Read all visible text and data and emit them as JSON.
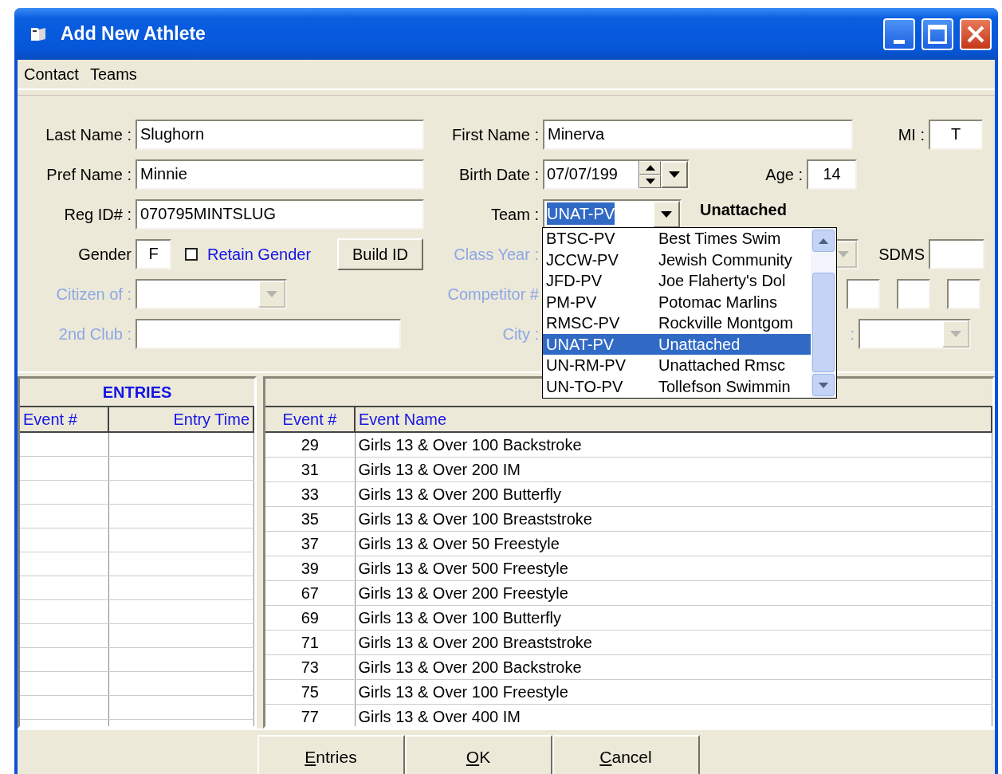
{
  "window": {
    "title": "Add New Athlete"
  },
  "menu": [
    {
      "label": "Contact"
    },
    {
      "label": "Teams"
    }
  ],
  "form": {
    "rows": [
      [
        {
          "kind": "text",
          "label": "Last Name :",
          "value": "Slughorn",
          "disabled": false,
          "highlighted": false
        },
        {
          "kind": "text",
          "label": "First Name :",
          "value": "Minerva",
          "disabled": false,
          "highlighted": false
        },
        {
          "kind": "text",
          "label": "MI :",
          "value": "T",
          "disabled": false,
          "highlighted": false
        }
      ],
      [
        {
          "kind": "text",
          "label": "Pref Name :",
          "value": "Minnie",
          "disabled": false,
          "highlighted": false
        },
        {
          "kind": "date",
          "label": "Birth Date :",
          "value": "07/07/199",
          "disabled": false,
          "highlighted": false
        },
        {
          "kind": "text",
          "label": "Age :",
          "value": "14",
          "disabled": false,
          "highlighted": false
        }
      ],
      [
        {
          "kind": "text",
          "label": "Reg ID# :",
          "value": "070795MINTSLUG",
          "disabled": false,
          "highlighted": false
        },
        {
          "kind": "combo",
          "label": "Team :",
          "value": "UNAT-PV",
          "disabled": false,
          "highlighted": true
        },
        {
          "kind": "note",
          "label": "Unattached"
        }
      ],
      [
        {
          "kind": "text",
          "label": "Gender",
          "value": "F",
          "disabled": false,
          "highlighted": false
        },
        {
          "kind": "checkbox",
          "label": "Retain Gender",
          "checked": false
        },
        {
          "kind": "button",
          "label": "Build ID"
        },
        {
          "kind": "combo",
          "label": "Class Year :",
          "disabled": true
        },
        {
          "kind": "text",
          "label": "SDMS",
          "disabled": false
        }
      ],
      [
        {
          "kind": "combo",
          "label": "Citizen of :",
          "disabled": true
        },
        {
          "kind": "multi",
          "label": "Competitor #",
          "disabled": true
        }
      ],
      [
        {
          "kind": "text",
          "label": "2nd Club :",
          "disabled": true
        },
        {
          "kind": "text",
          "label": "City :",
          "disabled": true
        },
        {
          "kind": "combo",
          "label": ":",
          "disabled": true
        }
      ]
    ]
  },
  "team_dropdown": {
    "items": [
      {
        "code": "BTSC-PV",
        "name": "Best Times Swim",
        "selected": false
      },
      {
        "code": "JCCW-PV",
        "name": "Jewish Community",
        "selected": false
      },
      {
        "code": "JFD-PV",
        "name": "Joe Flaherty's Dol",
        "selected": false
      },
      {
        "code": "PM-PV",
        "name": "Potomac Marlins",
        "selected": false
      },
      {
        "code": "RMSC-PV",
        "name": "Rockville Montgom",
        "selected": false
      },
      {
        "code": "UNAT-PV",
        "name": "Unattached",
        "selected": true
      },
      {
        "code": "UN-RM-PV",
        "name": "Unattached Rmsc",
        "selected": false
      },
      {
        "code": "UN-TO-PV",
        "name": "Tollefson Swimmin",
        "selected": false
      }
    ]
  },
  "entries_grid": {
    "title": "ENTRIES",
    "columns": [
      "Event #",
      "Entry Time"
    ]
  },
  "events_grid": {
    "columns": [
      "Event #",
      "Event Name"
    ],
    "rows": [
      [
        "29",
        "Girls 13 & Over 100 Backstroke"
      ],
      [
        "31",
        "Girls 13 & Over 200 IM"
      ],
      [
        "33",
        "Girls 13 & Over 200 Butterfly"
      ],
      [
        "35",
        "Girls 13 & Over 100 Breaststroke"
      ],
      [
        "37",
        "Girls 13 & Over 50 Freestyle"
      ],
      [
        "39",
        "Girls 13 & Over 500 Freestyle"
      ],
      [
        "67",
        "Girls 13 & Over 200 Freestyle"
      ],
      [
        "69",
        "Girls 13 & Over 100 Butterfly"
      ],
      [
        "71",
        "Girls 13 & Over 200 Breaststroke"
      ],
      [
        "73",
        "Girls 13 & Over 200 Backstroke"
      ],
      [
        "75",
        "Girls 13 & Over 100 Freestyle"
      ],
      [
        "77",
        "Girls 13 & Over 400 IM"
      ]
    ]
  },
  "buttons": [
    {
      "access_key": "E",
      "rest": "ntries"
    },
    {
      "access_key": "O",
      "rest": "K"
    },
    {
      "access_key": "C",
      "rest": "ancel"
    }
  ]
}
